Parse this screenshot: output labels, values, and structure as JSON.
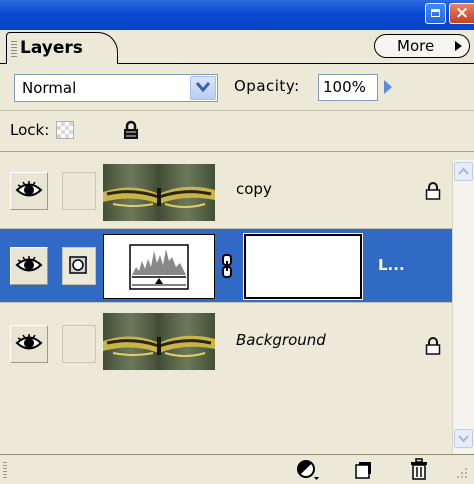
{
  "panel": {
    "tab_label": "Layers",
    "more_label": "More",
    "blend_mode": "Normal",
    "opacity_label": "Opacity:",
    "opacity_value": "100%",
    "lock_label": "Lock:",
    "win_close_glyph": "×"
  },
  "layers": [
    {
      "name": "copy",
      "visible": true,
      "locked": true,
      "selected": false,
      "thumb": "butterfly-photo"
    },
    {
      "name": "L...",
      "visible": true,
      "locked": false,
      "selected": true,
      "thumb": "levels-adjustment",
      "has_mask": true
    },
    {
      "name": "Background",
      "visible": true,
      "locked": true,
      "selected": false,
      "thumb": "butterfly-photo"
    }
  ],
  "icons": {
    "eye": "eye-icon",
    "lock": "lock-icon",
    "adjustment": "adjustment-layer-icon",
    "new_layer": "new-layer-icon",
    "trash": "trash-icon",
    "chain": "chain-link-icon"
  },
  "colors": {
    "selected_row": "#316ac5",
    "panel_bg": "#ece9d8",
    "title_blue": "#0a4bd0"
  }
}
